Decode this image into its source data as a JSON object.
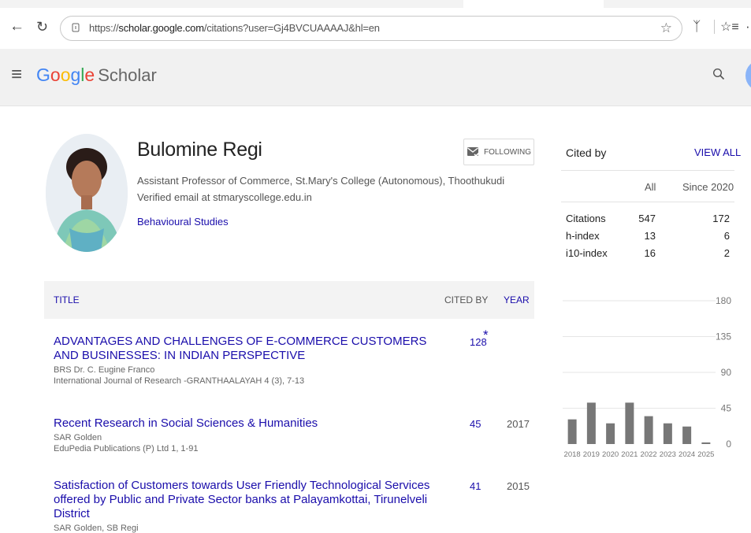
{
  "browser": {
    "url_prefix": "https://",
    "url_host": "scholar.google.com",
    "url_path": "/citations?user=Gj4BVCUAAAAJ&hl=en"
  },
  "header": {
    "logo_letters": [
      "G",
      "o",
      "o",
      "g",
      "l",
      "e"
    ],
    "logo_suffix": "Scholar"
  },
  "profile": {
    "name": "Bulomine Regi",
    "affiliation": "Assistant Professor of Commerce, St.Mary's College (Autonomous), Thoothukudi",
    "email": "Verified email at stmaryscollege.edu.in",
    "interest": "Behavioural Studies",
    "follow_label": "FOLLOWING"
  },
  "table": {
    "col_title": "TITLE",
    "col_cited": "CITED BY",
    "col_year": "YEAR"
  },
  "articles": [
    {
      "title": "ADVANTAGES AND CHALLENGES OF E-COMMERCE CUSTOMERS AND BUSINESSES: IN INDIAN PERSPECTIVE",
      "authors": "BRS Dr. C. Eugine Franco",
      "venue": "International Journal of Research -GRANTHAALAYAH 4 (3), 7-13",
      "cited": "128",
      "star": "*",
      "year": ""
    },
    {
      "title": "Recent Research in Social Sciences & Humanities",
      "authors": "SAR Golden",
      "venue": "EduPedia Publications (P) Ltd 1, 1-91",
      "cited": "45",
      "star": "",
      "year": "2017"
    },
    {
      "title": "Satisfaction of Customers towards User Friendly Technological Services offered by Public and Private Sector banks at Palayamkottai, Tirunelveli District",
      "authors": "SAR Golden, SB Regi",
      "venue": "",
      "cited": "41",
      "star": "",
      "year": "2015"
    }
  ],
  "cited_by": {
    "title": "Cited by",
    "view_all": "VIEW ALL",
    "col_all": "All",
    "col_since": "Since 2020",
    "rows": [
      {
        "label": "Citations",
        "all": "547",
        "since": "172"
      },
      {
        "label": "h-index",
        "all": "13",
        "since": "6"
      },
      {
        "label": "i10-index",
        "all": "16",
        "since": "2"
      }
    ]
  },
  "chart_data": {
    "type": "bar",
    "categories": [
      "2018",
      "2019",
      "2020",
      "2021",
      "2022",
      "2023",
      "2024",
      "2025"
    ],
    "values": [
      31,
      52,
      26,
      52,
      35,
      26,
      22,
      2
    ],
    "yticks": [
      0,
      45,
      90,
      135,
      180
    ],
    "ylim": [
      0,
      180
    ],
    "bar_color": "#777777"
  }
}
